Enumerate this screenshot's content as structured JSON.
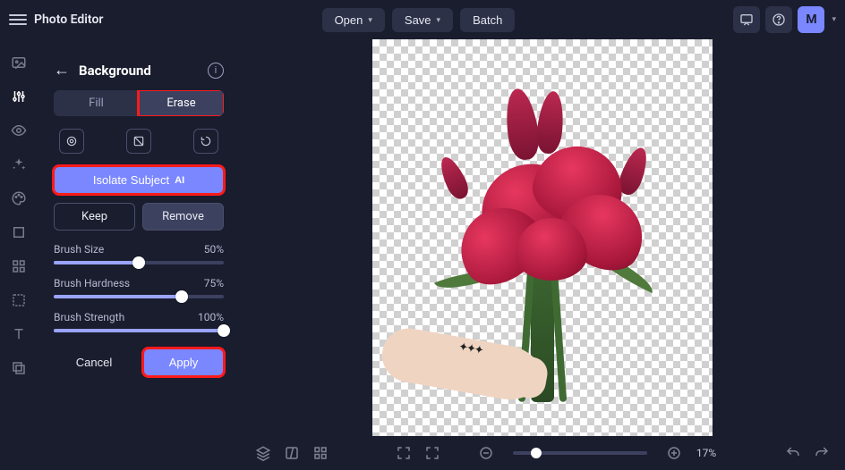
{
  "app": {
    "title": "Photo Editor"
  },
  "menu": {
    "open": "Open",
    "save": "Save",
    "batch": "Batch"
  },
  "avatar": {
    "initial": "M"
  },
  "panel": {
    "title": "Background",
    "tabs": {
      "fill": "Fill",
      "erase": "Erase"
    },
    "isolate": {
      "label": "Isolate Subject",
      "badge": "AI"
    },
    "keep": "Keep",
    "remove": "Remove",
    "sliders": {
      "size": {
        "label": "Brush Size",
        "value": "50%",
        "pct": 50
      },
      "hardness": {
        "label": "Brush Hardness",
        "value": "75%",
        "pct": 75
      },
      "strength": {
        "label": "Brush Strength",
        "value": "100%",
        "pct": 100
      }
    },
    "cancel": "Cancel",
    "apply": "Apply"
  },
  "zoom": {
    "value": "17%",
    "pct": 17
  }
}
